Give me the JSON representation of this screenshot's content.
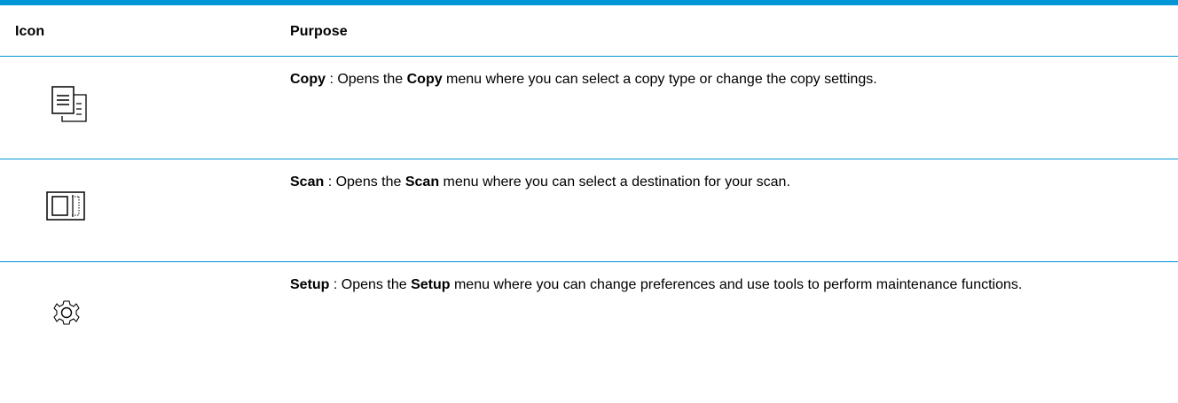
{
  "table": {
    "headers": {
      "icon": "Icon",
      "purpose": "Purpose"
    },
    "rows": [
      {
        "icon": "copy-icon",
        "name": "Copy",
        "sep": " : Opens the ",
        "menu": "Copy",
        "desc": " menu where you can select a copy type or change the copy settings."
      },
      {
        "icon": "scan-icon",
        "name": "Scan",
        "sep": " : Opens the ",
        "menu": "Scan",
        "desc": " menu where you can select a destination for your scan."
      },
      {
        "icon": "gear-icon",
        "name": "Setup",
        "sep": " : Opens the ",
        "menu": "Setup",
        "desc": " menu where you can change preferences and use tools to perform maintenance functions."
      }
    ]
  },
  "colors": {
    "rule": "#0096d6",
    "text": "#000000"
  }
}
